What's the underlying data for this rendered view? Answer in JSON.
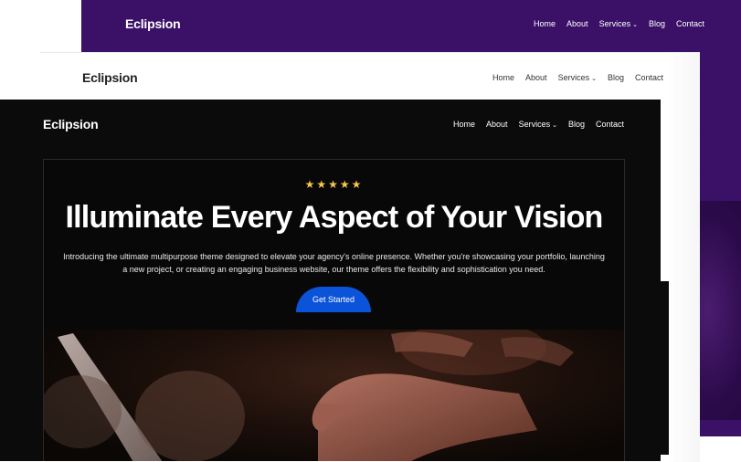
{
  "brand": "Eclipsion",
  "nav": {
    "items": [
      {
        "label": "Home"
      },
      {
        "label": "About"
      },
      {
        "label": "Services",
        "has_dropdown": true
      },
      {
        "label": "Blog"
      },
      {
        "label": "Contact"
      }
    ]
  },
  "hero": {
    "rating_stars": "★★★★★",
    "title": "Illuminate Every Aspect of Your Vision",
    "description": "Introducing the ultimate multipurpose theme designed to elevate your agency's online presence. Whether you're showcasing your portfolio, launching a new project, or creating an engaging business website, our theme offers the flexibility and sophistication you need.",
    "cta_label": "Get Started"
  },
  "colors": {
    "purple_layer": "#3a1167",
    "white_layer": "#ffffff",
    "dark_layer": "#0b0b0b",
    "accent_button": "#0b53d8",
    "stars": "#f5c84a"
  }
}
